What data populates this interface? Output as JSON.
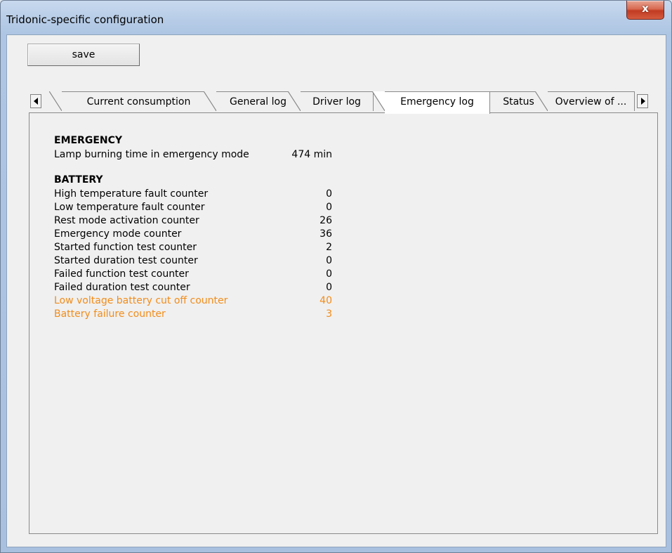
{
  "window": {
    "title": "Tridonic-specific configuration",
    "close_glyph": "x"
  },
  "toolbar": {
    "save_label": "save"
  },
  "tabs": [
    {
      "label": "Current consumption",
      "active": false
    },
    {
      "label": "General log",
      "active": false
    },
    {
      "label": "Driver log",
      "active": false
    },
    {
      "label": "Emergency log",
      "active": true
    },
    {
      "label": "Status",
      "active": false
    },
    {
      "label": "Overview of ...",
      "active": false
    }
  ],
  "icons": {
    "tab_scroll_left": "triangle-left-icon",
    "tab_scroll_right": "triangle-right-icon"
  },
  "emergency": {
    "header": "EMERGENCY",
    "rows": [
      {
        "label": "Lamp burning time in emergency mode",
        "value": "474 min"
      }
    ]
  },
  "battery": {
    "header": "BATTERY",
    "rows": [
      {
        "label": "High temperature fault counter",
        "value": "0",
        "warning": false
      },
      {
        "label": "Low temperature fault counter",
        "value": "0",
        "warning": false
      },
      {
        "label": "Rest mode activation counter",
        "value": "26",
        "warning": false
      },
      {
        "label": "Emergency mode counter",
        "value": "36",
        "warning": false
      },
      {
        "label": "Started function test counter",
        "value": "2",
        "warning": false
      },
      {
        "label": "Started duration test counter",
        "value": "0",
        "warning": false
      },
      {
        "label": "Failed function test counter",
        "value": "0",
        "warning": false
      },
      {
        "label": "Failed duration test counter",
        "value": "0",
        "warning": false
      },
      {
        "label": "Low voltage battery cut off counter",
        "value": "40",
        "warning": true
      },
      {
        "label": "Battery failure counter",
        "value": "3",
        "warning": true
      }
    ]
  },
  "colors": {
    "warning_text": "#f28c1a",
    "close_button": "#c13b22"
  }
}
